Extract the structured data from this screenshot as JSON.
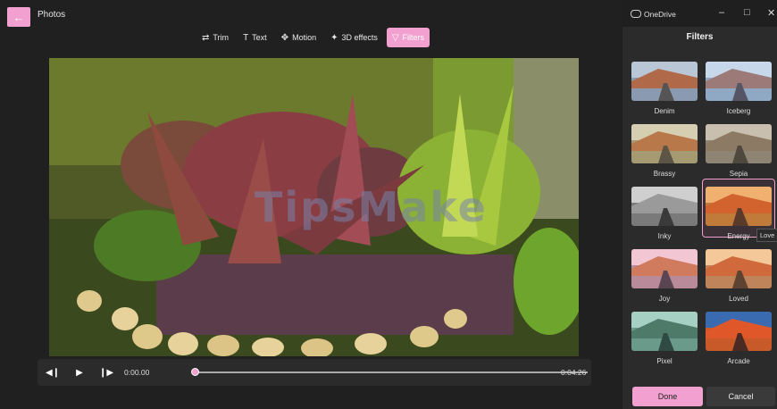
{
  "app": {
    "title": "Photos",
    "back_icon": "arrow-left-icon"
  },
  "toolbar": {
    "items": [
      {
        "label": "Trim",
        "icon": "trim-icon",
        "active": false
      },
      {
        "label": "Text",
        "icon": "text-icon",
        "active": false
      },
      {
        "label": "Motion",
        "icon": "motion-icon",
        "active": false
      },
      {
        "label": "3D effects",
        "icon": "3d-effects-icon",
        "active": false
      },
      {
        "label": "Filters",
        "icon": "filters-icon",
        "active": true
      }
    ]
  },
  "player": {
    "current_time": "0:00.00",
    "total_time": "0:04.26",
    "progress": 0
  },
  "panel": {
    "cloud_label": "OneDrive",
    "title": "Filters",
    "filters": [
      {
        "label": "Denim",
        "selected": false
      },
      {
        "label": "Iceberg",
        "selected": false
      },
      {
        "label": "Brassy",
        "selected": false
      },
      {
        "label": "Sepia",
        "selected": false
      },
      {
        "label": "Inky",
        "selected": false
      },
      {
        "label": "Energy",
        "selected": true
      },
      {
        "label": "Joy",
        "selected": false
      },
      {
        "label": "Loved",
        "selected": false
      },
      {
        "label": "Pixel",
        "selected": false
      },
      {
        "label": "Arcade",
        "selected": false
      }
    ],
    "tooltip": "Love",
    "done_label": "Done",
    "cancel_label": "Cancel"
  },
  "watermark": "TipsMake",
  "colors": {
    "accent": "#f2a0cf",
    "background": "#202020",
    "panel": "#2b2b2b"
  }
}
